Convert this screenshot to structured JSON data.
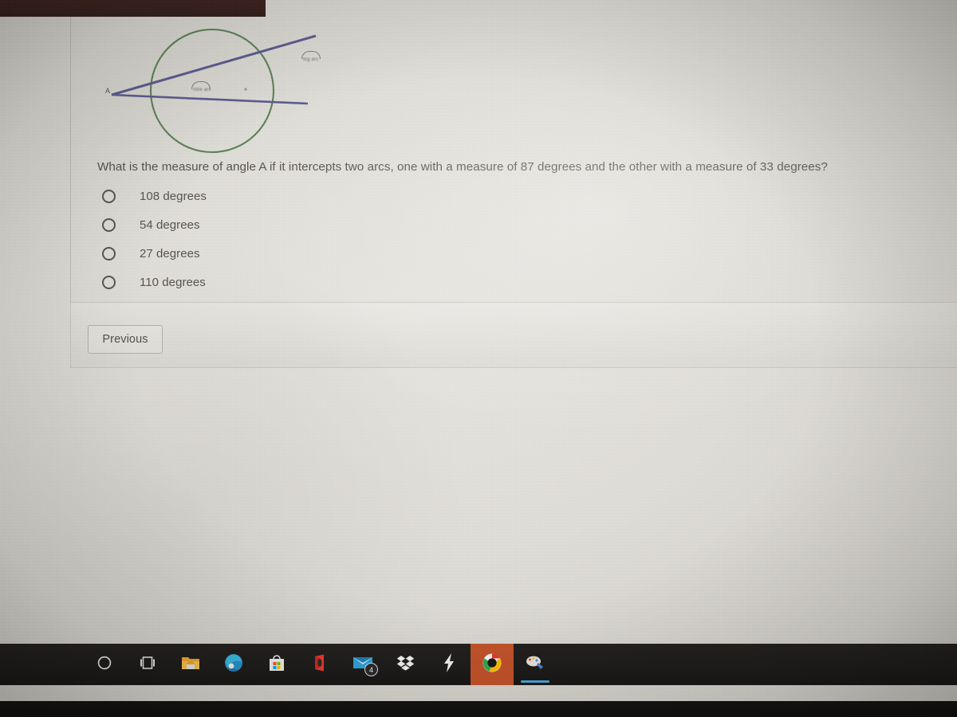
{
  "window": {
    "top_band_name": "browser-title-band"
  },
  "diagram": {
    "vertex_label": "A",
    "circle_color": "#5d8159",
    "secant_color": "#5c5c8f",
    "near_arc_label": "little arc",
    "far_arc_label": "big arc",
    "center_dot": "center-point"
  },
  "question": {
    "text": "What is the measure of angle A if it intercepts two arcs, one with a measure of 87 degrees and the other with a measure of 33 degrees?"
  },
  "options": [
    {
      "label": "108 degrees",
      "selected": false
    },
    {
      "label": "54 degrees",
      "selected": false
    },
    {
      "label": "27 degrees",
      "selected": false
    },
    {
      "label": "110 degrees",
      "selected": false
    }
  ],
  "buttons": {
    "previous": "Previous"
  },
  "taskbar": {
    "items": [
      {
        "name": "cortana-icon",
        "label": "Cortana"
      },
      {
        "name": "task-view-icon",
        "label": "Task View"
      },
      {
        "name": "file-explorer-icon",
        "label": "File Explorer"
      },
      {
        "name": "microsoft-edge-icon",
        "label": "Microsoft Edge"
      },
      {
        "name": "microsoft-store-icon",
        "label": "Microsoft Store"
      },
      {
        "name": "office-icon",
        "label": "Office"
      },
      {
        "name": "mail-icon",
        "label": "Mail",
        "badge": "4"
      },
      {
        "name": "dropbox-icon",
        "label": "Dropbox"
      },
      {
        "name": "lightning-app-icon",
        "label": "Lightning App"
      },
      {
        "name": "google-chrome-icon",
        "label": "Google Chrome",
        "active_tile": true
      },
      {
        "name": "paint-app-icon",
        "label": "Paint 3D",
        "running": true
      }
    ]
  },
  "colors": {
    "screen_bg": "#ded Cd6",
    "taskbar_bg": "#1f1d1b",
    "active_tile": "#c0522a",
    "running_underline": "#4aa3d8",
    "top_band": "#3a221e"
  }
}
